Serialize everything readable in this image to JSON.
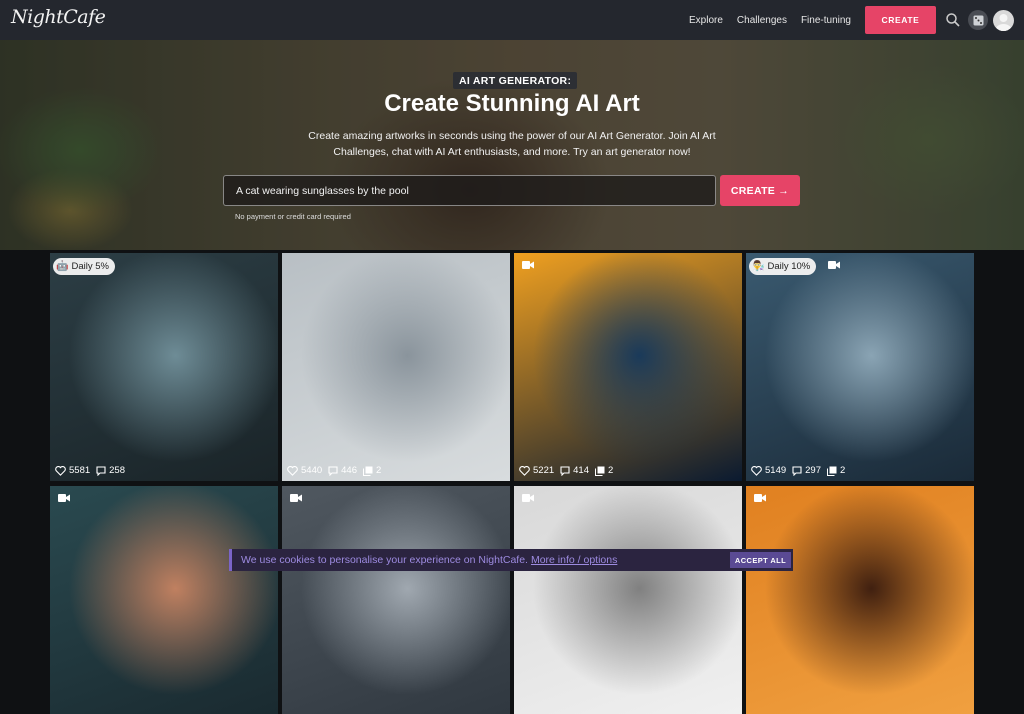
{
  "nav": {
    "logo": "NightCafe",
    "links": [
      "Explore",
      "Challenges",
      "Fine-tuning"
    ],
    "create_label": "CREATE",
    "icons": [
      "search-icon",
      "dice-icon",
      "avatar"
    ]
  },
  "hero": {
    "badge": "AI ART GENERATOR:",
    "title": "Create Stunning AI Art",
    "subtitle": "Create amazing artworks in seconds using the power of our AI Art Generator. Join AI Art Challenges, chat with AI Art enthusiasts, and more. Try an art generator now!",
    "prompt_value": "A cat wearing sunglasses by the pool",
    "create_label": "CREATE →",
    "note": "No payment or credit card required"
  },
  "gallery": {
    "cards": [
      {
        "badge": "Daily 5%",
        "badge_icon": "robot-icon",
        "video": false,
        "likes": "5581",
        "comments": "258",
        "images": null,
        "colors": [
          "#2c3e45",
          "#6e8c96",
          "#1a2428"
        ]
      },
      {
        "badge": null,
        "video": false,
        "likes": "5440",
        "comments": "446",
        "images": "2",
        "colors": [
          "#b8bfc4",
          "#8a949c",
          "#d8dcde"
        ]
      },
      {
        "badge": null,
        "video": true,
        "likes": "5221",
        "comments": "414",
        "images": "2",
        "colors": [
          "#f0a020",
          "#1a3a5a",
          "#0a1a30"
        ]
      },
      {
        "badge": "Daily 10%",
        "badge_icon": "scientist-icon",
        "video": true,
        "likes": "5149",
        "comments": "297",
        "images": "2",
        "colors": [
          "#3a5a70",
          "#8aa4b4",
          "#1a2a38"
        ]
      },
      {
        "badge": null,
        "video": true,
        "likes": null,
        "comments": null,
        "images": null,
        "colors": [
          "#2a4a50",
          "#c08060",
          "#1a2a30"
        ]
      },
      {
        "badge": null,
        "video": true,
        "likes": null,
        "comments": null,
        "images": null,
        "colors": [
          "#505860",
          "#a0a8b0",
          "#303840"
        ]
      },
      {
        "badge": null,
        "video": true,
        "likes": null,
        "comments": null,
        "images": null,
        "colors": [
          "#d8d8d8",
          "#808080",
          "#f0f0f0"
        ]
      },
      {
        "badge": null,
        "video": true,
        "likes": null,
        "comments": null,
        "images": null,
        "colors": [
          "#e08020",
          "#402010",
          "#f0a040"
        ]
      }
    ]
  },
  "cookie": {
    "text": "We use cookies to personalise your experience on NightCafe.",
    "link": "More info / options",
    "accept_label": "ACCEPT ALL"
  }
}
